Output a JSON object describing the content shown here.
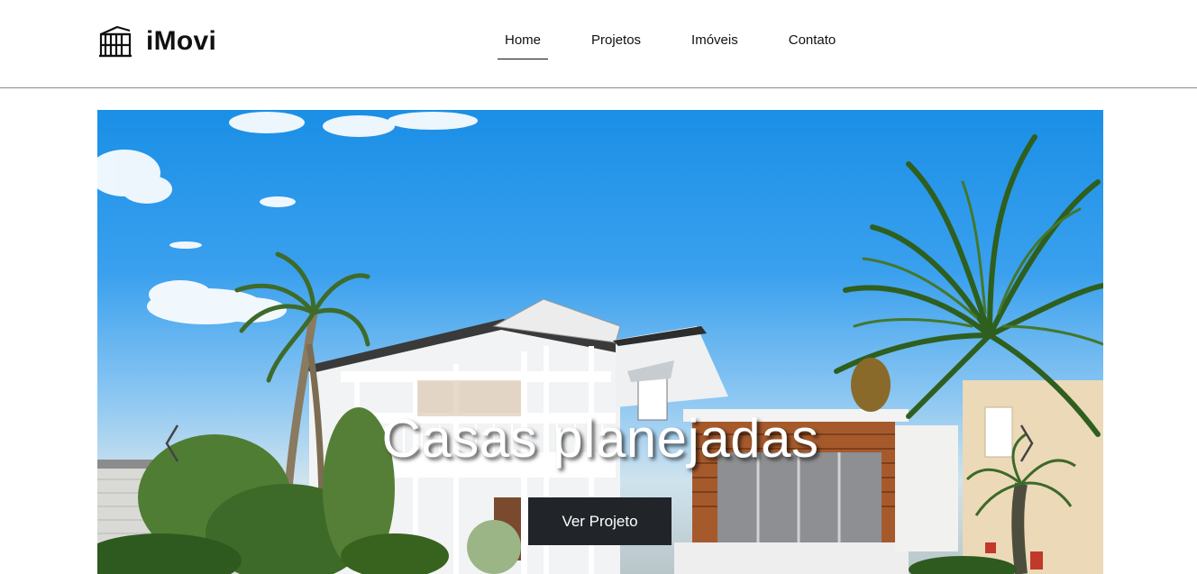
{
  "brand": {
    "name": "iMovi",
    "icon": "building-icon"
  },
  "nav": {
    "items": [
      {
        "label": "Home",
        "active": true
      },
      {
        "label": "Projetos",
        "active": false
      },
      {
        "label": "Imóveis",
        "active": false
      },
      {
        "label": "Contato",
        "active": false
      }
    ]
  },
  "hero": {
    "caption": "Casas planejadas",
    "cta_label": "Ver Projeto",
    "prev_icon": "chevron-left-icon",
    "next_icon": "chevron-right-icon"
  },
  "colors": {
    "cta_background": "#212529",
    "header_border": "#8a8a8a",
    "sky": "#1a8fe6"
  }
}
